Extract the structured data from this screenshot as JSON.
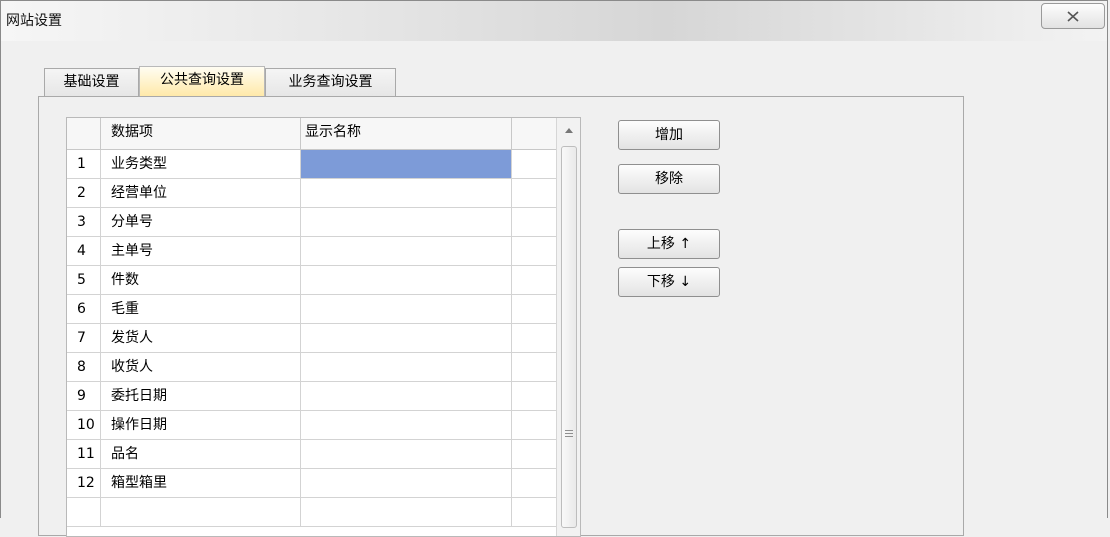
{
  "window": {
    "title": "网站设置"
  },
  "tabs": [
    {
      "label": "基础设置",
      "active": false
    },
    {
      "label": "公共查询设置",
      "active": true
    },
    {
      "label": "业务查询设置",
      "active": false
    }
  ],
  "grid": {
    "columns": [
      "数据项",
      "显示名称"
    ],
    "rows": [
      {
        "num": "1",
        "item": "业务类型",
        "display": ""
      },
      {
        "num": "2",
        "item": "经营单位",
        "display": ""
      },
      {
        "num": "3",
        "item": "分单号",
        "display": ""
      },
      {
        "num": "4",
        "item": "主单号",
        "display": ""
      },
      {
        "num": "5",
        "item": "件数",
        "display": ""
      },
      {
        "num": "6",
        "item": "毛重",
        "display": ""
      },
      {
        "num": "7",
        "item": "发货人",
        "display": ""
      },
      {
        "num": "8",
        "item": "收货人",
        "display": ""
      },
      {
        "num": "9",
        "item": "委托日期",
        "display": ""
      },
      {
        "num": "10",
        "item": "操作日期",
        "display": ""
      },
      {
        "num": "11",
        "item": "品名",
        "display": ""
      },
      {
        "num": "12",
        "item": "箱型箱里",
        "display": ""
      },
      {
        "num": "",
        "item": "",
        "display": ""
      }
    ],
    "selected_cell": "row 1, 显示名称"
  },
  "buttons": {
    "add": "增加",
    "remove": "移除",
    "move_up": "上移 ↑",
    "move_down": "下移 ↓"
  },
  "icons": {
    "close": "close-icon",
    "scroll_up": "scroll-up-arrow-icon",
    "scroll_grip": "scroll-grip-icon"
  }
}
